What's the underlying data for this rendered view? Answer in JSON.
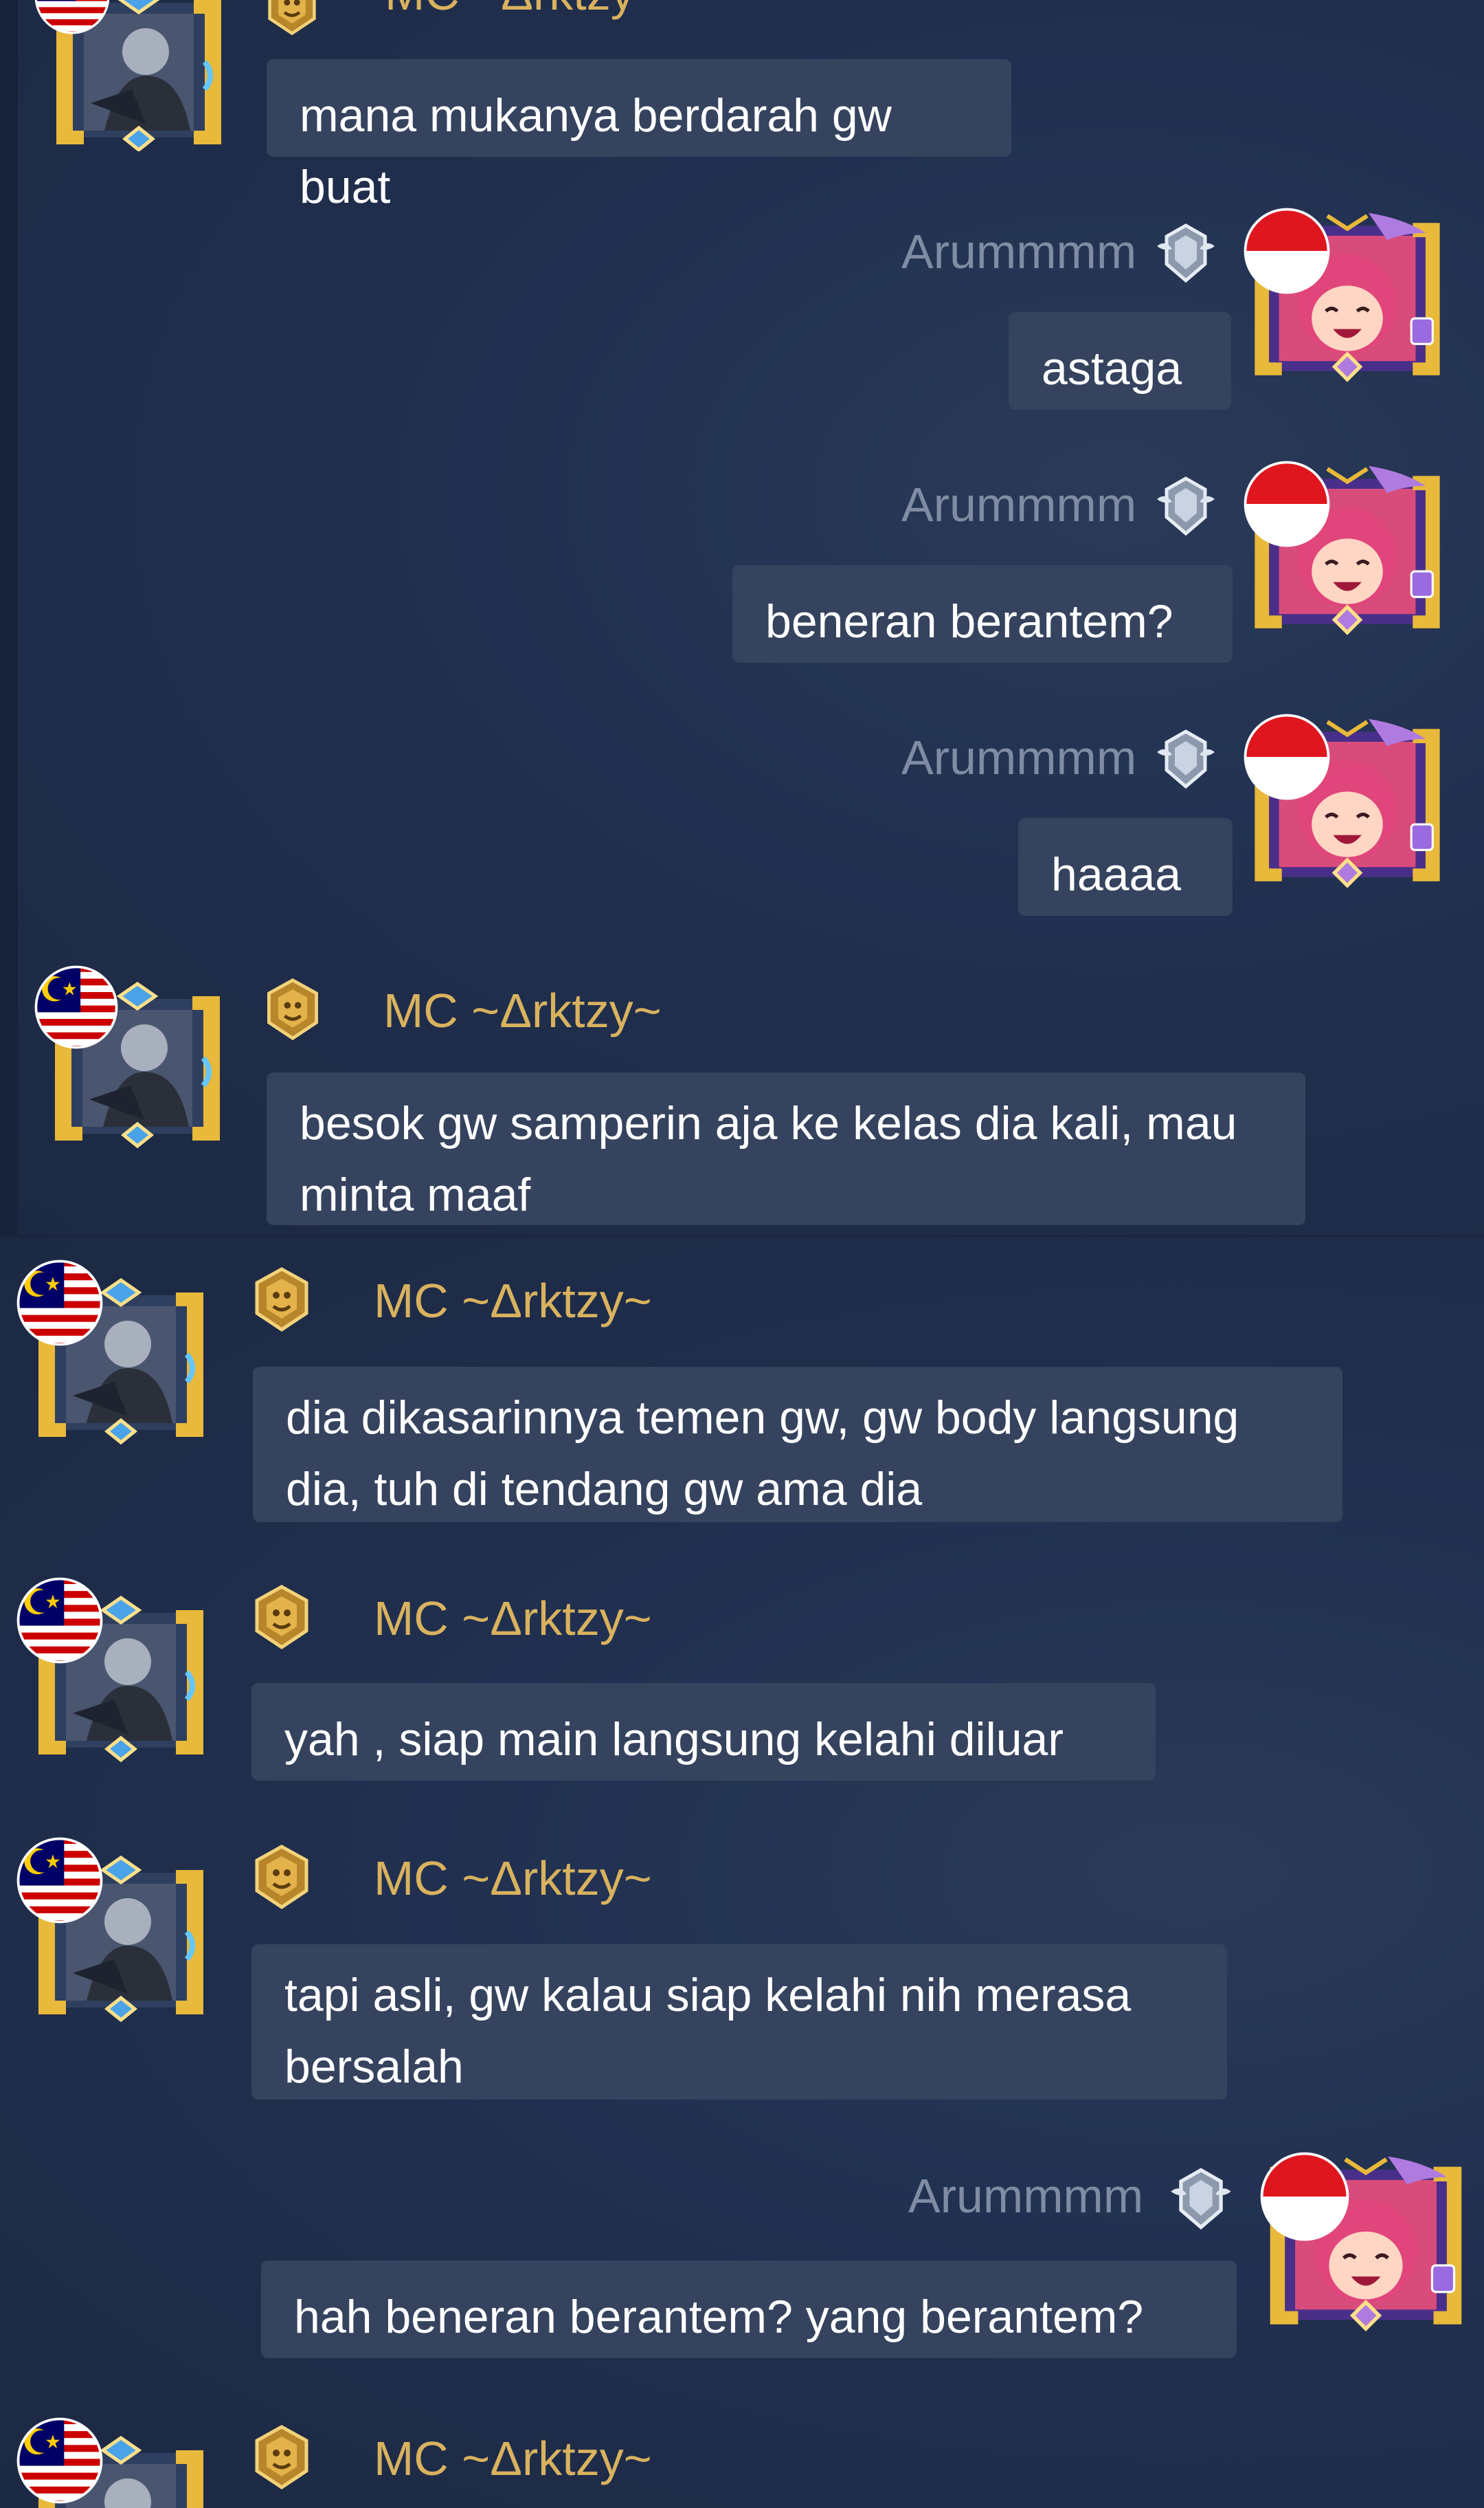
{
  "users": {
    "left": "MC ~Δrktzy~",
    "right": "Arummmm"
  },
  "top_panel": {
    "partial_name": "MC ~Δrktzy~",
    "messages": [
      {
        "sender": "left",
        "text": "mana mukanya berdarah gw buat",
        "show_name": false
      },
      {
        "sender": "right",
        "text": "astaga"
      },
      {
        "sender": "right",
        "text": "beneran berantem?"
      },
      {
        "sender": "right",
        "text": "haaaa"
      },
      {
        "sender": "left",
        "text": "besok gw samperin aja ke kelas dia kali, mau minta maaf"
      }
    ]
  },
  "bottom_panel": {
    "messages": [
      {
        "sender": "left",
        "text": "dia dikasarinnya temen gw, gw body langsung dia, tuh di tendang gw ama dia"
      },
      {
        "sender": "left",
        "text": "yah , siap main langsung kelahi diluar"
      },
      {
        "sender": "left",
        "text": "tapi asli, gw kalau siap kelahi nih merasa bersalah"
      },
      {
        "sender": "right",
        "text": "hah beneran berantem? yang berantem?"
      },
      {
        "sender": "left",
        "text": ""
      }
    ]
  },
  "colors": {
    "background": "#1f2d47",
    "bubble": "#35435e",
    "left_name": "#d9b25e",
    "right_name": "#7f8ca3",
    "frame_gold": "#e8b93a",
    "frame_purple": "#7b4fd1"
  },
  "icons": {
    "left_flag": "malaysia-flag-icon",
    "right_flag": "indonesia-flag-icon",
    "left_rank": "gold-lion-rank-icon",
    "right_rank": "silver-wing-rank-icon"
  }
}
